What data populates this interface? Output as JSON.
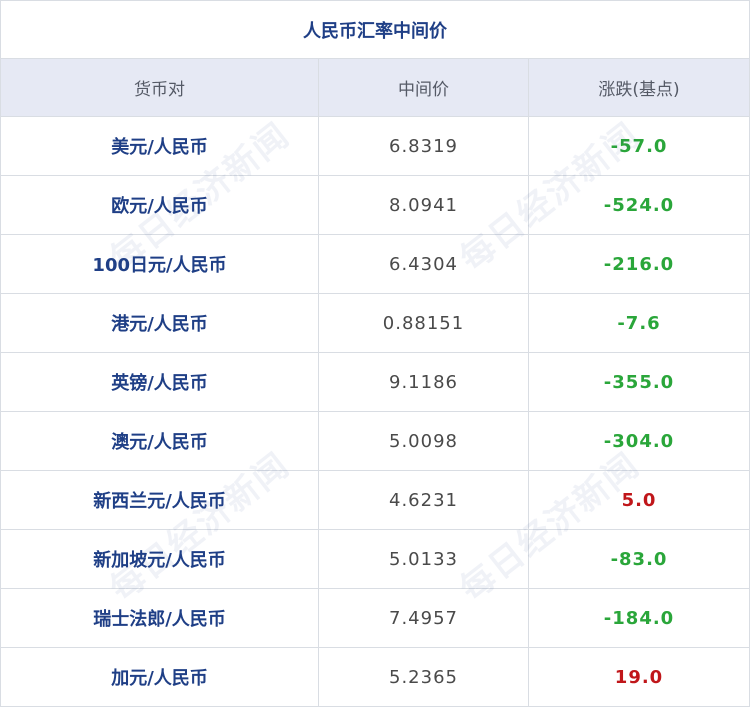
{
  "title": "人民币汇率中间价",
  "headers": [
    "货币对",
    "中间价",
    "涨跌(基点)"
  ],
  "rows": [
    {
      "pair": "美元/人民币",
      "mid": "6.8319",
      "change": "-57.0",
      "direction": "down"
    },
    {
      "pair": "欧元/人民币",
      "mid": "8.0941",
      "change": "-524.0",
      "direction": "down"
    },
    {
      "pair": "100日元/人民币",
      "mid": "6.4304",
      "change": "-216.0",
      "direction": "down"
    },
    {
      "pair": "港元/人民币",
      "mid": "0.88151",
      "change": "-7.6",
      "direction": "down"
    },
    {
      "pair": "英镑/人民币",
      "mid": "9.1186",
      "change": "-355.0",
      "direction": "down"
    },
    {
      "pair": "澳元/人民币",
      "mid": "5.0098",
      "change": "-304.0",
      "direction": "down"
    },
    {
      "pair": "新西兰元/人民币",
      "mid": "4.6231",
      "change": "5.0",
      "direction": "up"
    },
    {
      "pair": "新加坡元/人民币",
      "mid": "5.0133",
      "change": "-83.0",
      "direction": "down"
    },
    {
      "pair": "瑞士法郎/人民币",
      "mid": "7.4957",
      "change": "-184.0",
      "direction": "down"
    },
    {
      "pair": "加元/人民币",
      "mid": "5.2365",
      "change": "19.0",
      "direction": "up"
    }
  ],
  "watermark": "每日经济新闻",
  "colors": {
    "title": "#1f3f86",
    "header_bg": "#e6e9f4",
    "down": "#2aa63a",
    "up": "#c0161a"
  }
}
